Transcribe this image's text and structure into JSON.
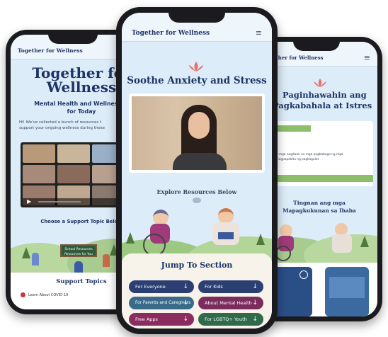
{
  "left_phone": {
    "brand": "Together for Wellness",
    "hero_title_line1": "Together for",
    "hero_title_line2": "Wellness",
    "subtitle_line1": "Mental Health and Wellness Ti",
    "subtitle_line2": "for Today",
    "intro_line1": "Hi! We've collected a bunch of resources t",
    "intro_line2": "support your ongoing wellness during these",
    "choose_topic": "Choose a Support Topic Below",
    "sign_line1": "School Resources",
    "sign_line2": "Resources for You",
    "support_topics": "Support Topics",
    "topic_link": "Learn About COVID-19"
  },
  "center_phone": {
    "brand": "Together for Wellness",
    "page_title": "Soothe Anxiety and Stress",
    "explore": "Explore Resources Below",
    "jump_title": "Jump To Section",
    "buttons": [
      {
        "label": "For Everyone",
        "color": "#2b3f73"
      },
      {
        "label": "For Kids",
        "color": "#2b3f73"
      },
      {
        "label": "For Parents and Caregivers",
        "color": "#3a6a8a"
      },
      {
        "label": "About Mental Health",
        "color": "#7a2c5c"
      },
      {
        "label": "Free Apps",
        "color": "#8a2c60"
      },
      {
        "label": "For LGBTQ+ Youth",
        "color": "#2f6a4a"
      }
    ]
  },
  "right_phone": {
    "brand": "Together for Wellness",
    "title_line1": "Paginhawahin ang",
    "title_line2": "Pagkabahala at Istres",
    "card_text_line1": "Ang iyong mga nagdaan na mga pagbabago ng mga",
    "card_text_line2": "aralin ay nagpapakita ng pagkagulat",
    "explore_line1": "Tingnan ang mga",
    "explore_line2": "Mapagkukunan sa Ibaba"
  },
  "colors": {
    "navy": "#1d3466",
    "lotus": "#e8716c",
    "sky": "#dcecf8",
    "grass": "#8dbf6a"
  }
}
